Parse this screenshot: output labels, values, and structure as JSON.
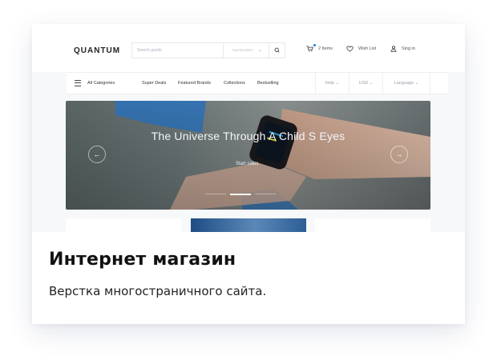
{
  "portfolio": {
    "title": "Интернет магазин",
    "subtitle": "Верстка многостраничного сайта."
  },
  "site": {
    "logo": "QUANTUM",
    "search": {
      "placeholder": "Search goods",
      "category": "CATEGORY"
    },
    "header": {
      "cart_label": "2 Items",
      "cart_icon": "cart-icon",
      "wishlist_label": "Wish List",
      "wishlist_icon": "heart-icon",
      "signin_label": "Sing in",
      "signin_icon": "user-icon"
    },
    "nav": {
      "all_categories": "All Categories",
      "links": [
        "Super Deals",
        "Featured Brands",
        "Collections",
        "Bestselling"
      ],
      "help": "Help",
      "currency": "USD",
      "language": "Language"
    },
    "hero": {
      "title": "The Universe Through A Child S Eyes",
      "button": "Start sales",
      "slides_total": 3,
      "active_slide": 2
    }
  },
  "colors": {
    "accent": "#1f7fd8",
    "card_bg": "#ffffff",
    "text": "#111111"
  }
}
